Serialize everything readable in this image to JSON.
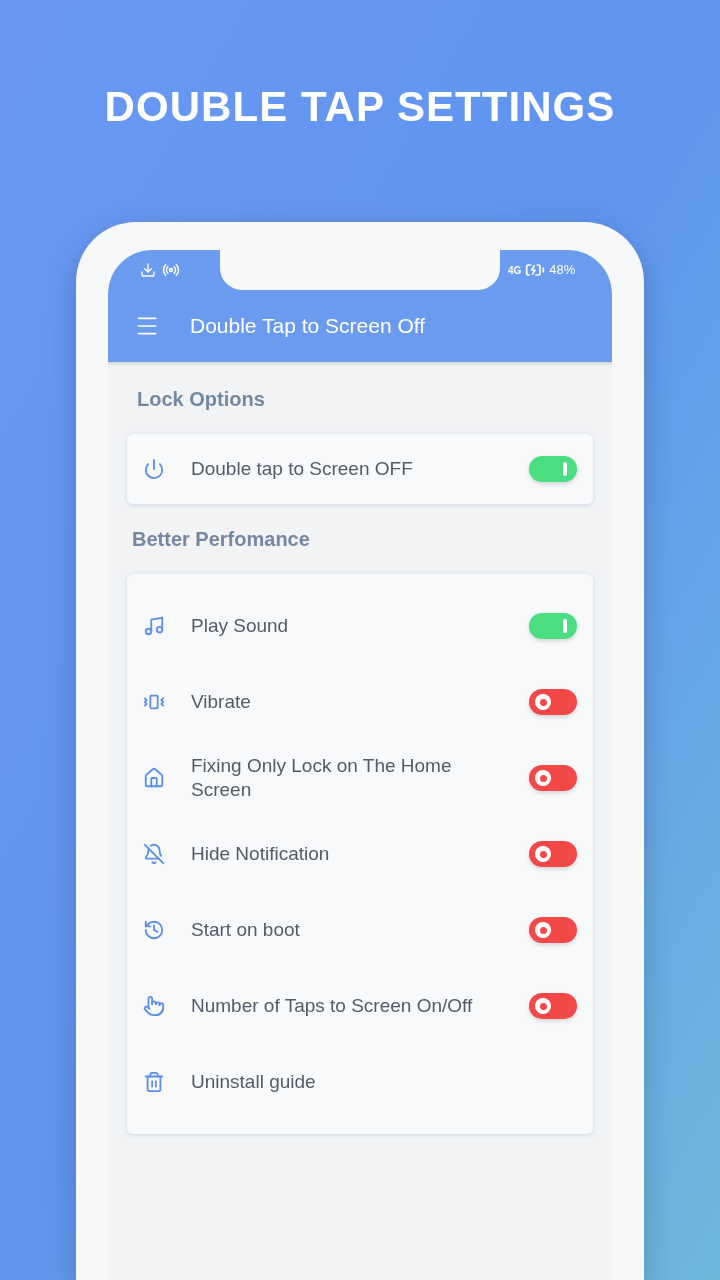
{
  "headline": "DOUBLE TAP SETTINGS",
  "status_bar": {
    "network": "4G",
    "battery": "48%"
  },
  "app_bar": {
    "title": "Double Tap to Screen Off"
  },
  "sections": [
    {
      "title": "Lock Options",
      "items": [
        {
          "label": "Double tap to Screen OFF",
          "kind": "toggle",
          "on": true
        }
      ]
    },
    {
      "title": "Better Perfomance",
      "items": [
        {
          "label": "Play Sound",
          "kind": "toggle",
          "on": true
        },
        {
          "label": "Vibrate",
          "kind": "toggle",
          "on": false
        },
        {
          "label": "Fixing Only Lock on The Home Screen",
          "kind": "toggle",
          "on": false
        },
        {
          "label": "Hide Notification",
          "kind": "toggle",
          "on": false
        },
        {
          "label": "Start on boot",
          "kind": "toggle",
          "on": false
        },
        {
          "label": "Number of Taps to Screen On/Off",
          "kind": "toggle",
          "on": false
        },
        {
          "label": "Uninstall guide",
          "kind": "link"
        }
      ]
    }
  ]
}
